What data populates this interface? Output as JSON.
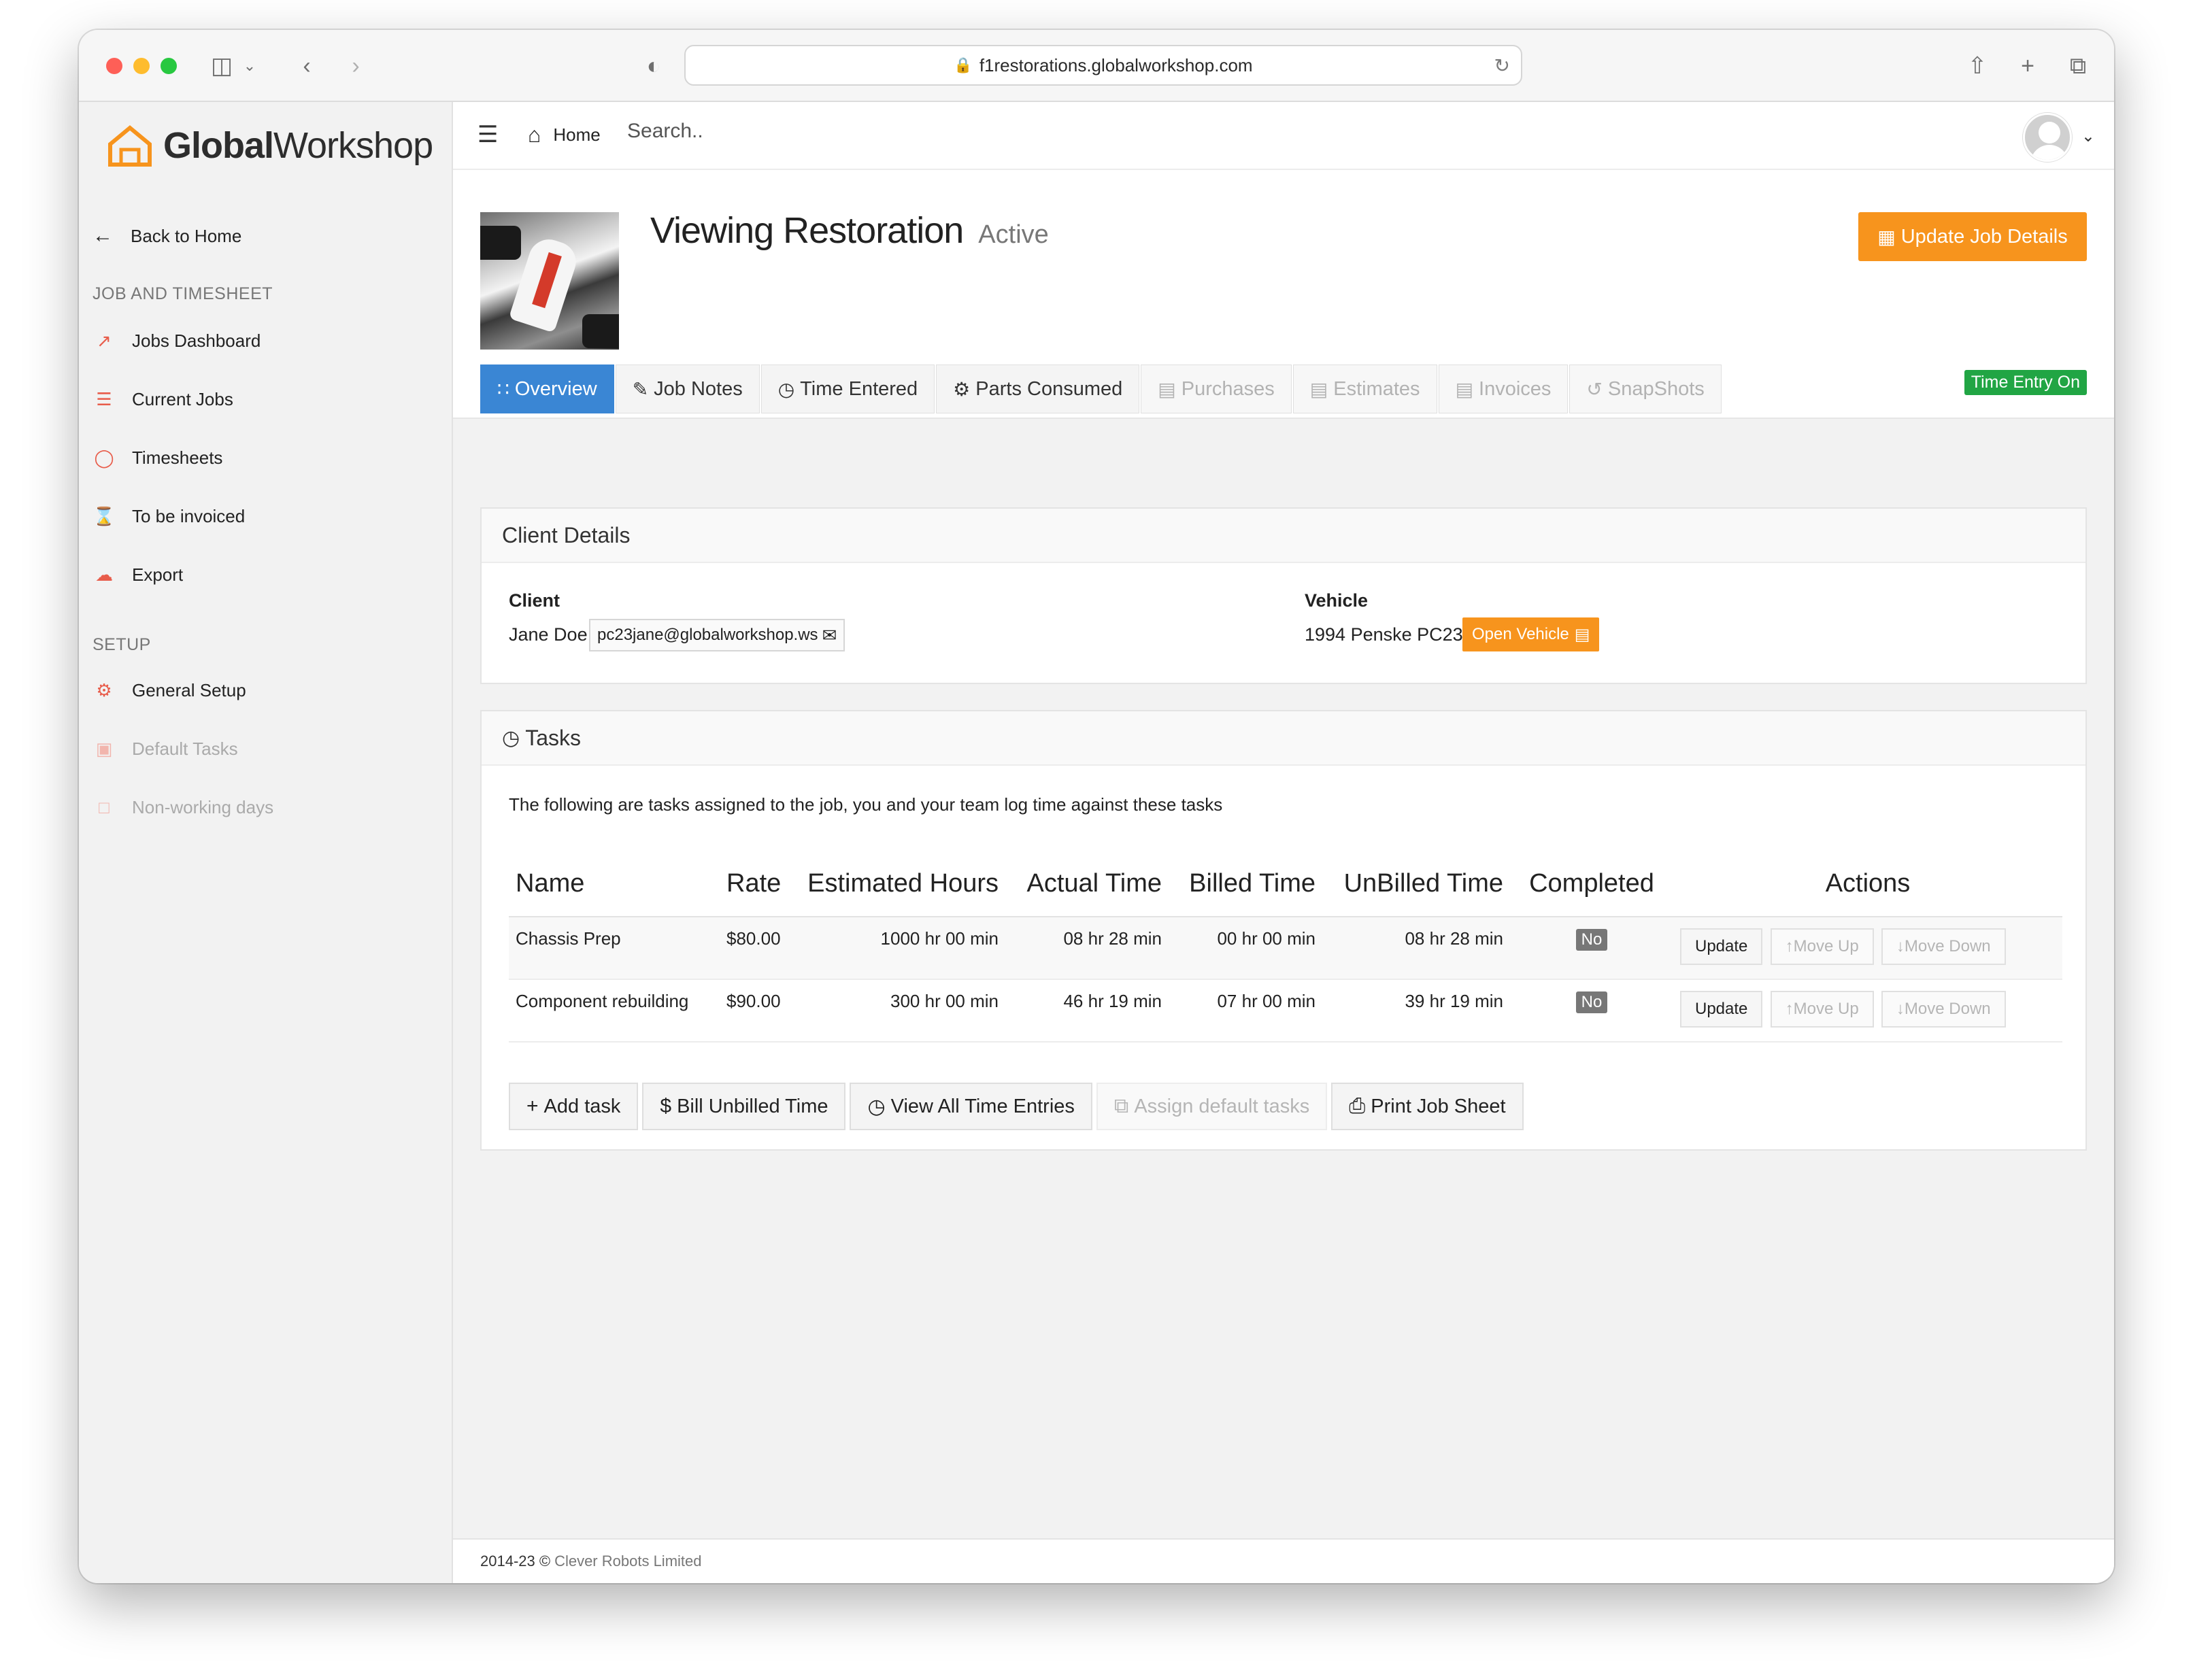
{
  "browser": {
    "url": "f1restorations.globalworkshop.com"
  },
  "sidebar": {
    "logo": {
      "bold": "Global",
      "regular": "Workshop"
    },
    "back_home": "Back to Home",
    "section_job": "JOB AND TIMESHEET",
    "job_items": [
      {
        "label": "Jobs Dashboard",
        "icon": "chart-icon"
      },
      {
        "label": "Current Jobs",
        "icon": "list-icon"
      },
      {
        "label": "Timesheets",
        "icon": "stopwatch-icon"
      },
      {
        "label": "To be invoiced",
        "icon": "hourglass-icon"
      },
      {
        "label": "Export",
        "icon": "cloud-download-icon"
      }
    ],
    "section_setup": "SETUP",
    "setup_items": [
      {
        "label": "General Setup",
        "icon": "gears-icon",
        "enabled": true
      },
      {
        "label": "Default Tasks",
        "icon": "truck-icon",
        "enabled": false
      },
      {
        "label": "Non-working days",
        "icon": "calendar-icon",
        "enabled": false
      }
    ]
  },
  "topnav": {
    "home": "Home",
    "search_placeholder": "Search.."
  },
  "job": {
    "title": "Viewing Restoration",
    "status": "Active",
    "update_button": "Update Job Details",
    "time_entry_badge": "Time Entry On"
  },
  "tabs": [
    {
      "label": "Overview",
      "icon": "grid-icon",
      "state": "active"
    },
    {
      "label": "Job Notes",
      "icon": "pencil-icon",
      "state": "normal"
    },
    {
      "label": "Time Entered",
      "icon": "clock-icon",
      "state": "normal"
    },
    {
      "label": "Parts Consumed",
      "icon": "gears-icon",
      "state": "normal"
    },
    {
      "label": "Purchases",
      "icon": "document-icon",
      "state": "disabled"
    },
    {
      "label": "Estimates",
      "icon": "document-icon",
      "state": "disabled"
    },
    {
      "label": "Invoices",
      "icon": "document-icon",
      "state": "disabled"
    },
    {
      "label": "SnapShots",
      "icon": "history-icon",
      "state": "disabled"
    }
  ],
  "client_details": {
    "heading": "Client Details",
    "client_label": "Client",
    "client_name": "Jane Doe",
    "client_email": "pc23jane@globalworkshop.ws",
    "vehicle_label": "Vehicle",
    "vehicle_name": "1994 Penske PC23",
    "open_vehicle": "Open Vehicle"
  },
  "tasks": {
    "heading": "Tasks",
    "intro": "The following are tasks assigned to the job, you and your team log time against these tasks",
    "columns": [
      "Name",
      "Rate",
      "Estimated Hours",
      "Actual Time",
      "Billed Time",
      "UnBilled Time",
      "Completed",
      "Actions"
    ],
    "rows": [
      {
        "name": "Chassis Prep",
        "rate": "$80.00",
        "estimated": "1000 hr 00 min",
        "actual": "08 hr 28 min",
        "billed": "00 hr 00 min",
        "unbilled": "08 hr 28 min",
        "completed": "No"
      },
      {
        "name": "Component rebuilding",
        "rate": "$90.00",
        "estimated": "300 hr 00 min",
        "actual": "46 hr 19 min",
        "billed": "07 hr 00 min",
        "unbilled": "39 hr 19 min",
        "completed": "No"
      }
    ],
    "row_actions": {
      "update": "Update",
      "move_up": "Move Up",
      "move_down": "Move Down"
    },
    "buttons": {
      "add_task": "Add task",
      "bill_unbilled": "Bill Unbilled Time",
      "view_all": "View All Time Entries",
      "assign_default": "Assign default tasks",
      "print": "Print Job Sheet"
    }
  },
  "footer": {
    "year": "2014-23 ©",
    "company": "Clever Robots Limited"
  },
  "colors": {
    "accent_orange": "#f7941d",
    "tab_active_blue": "#3a86d4",
    "badge_green": "#21a544"
  }
}
